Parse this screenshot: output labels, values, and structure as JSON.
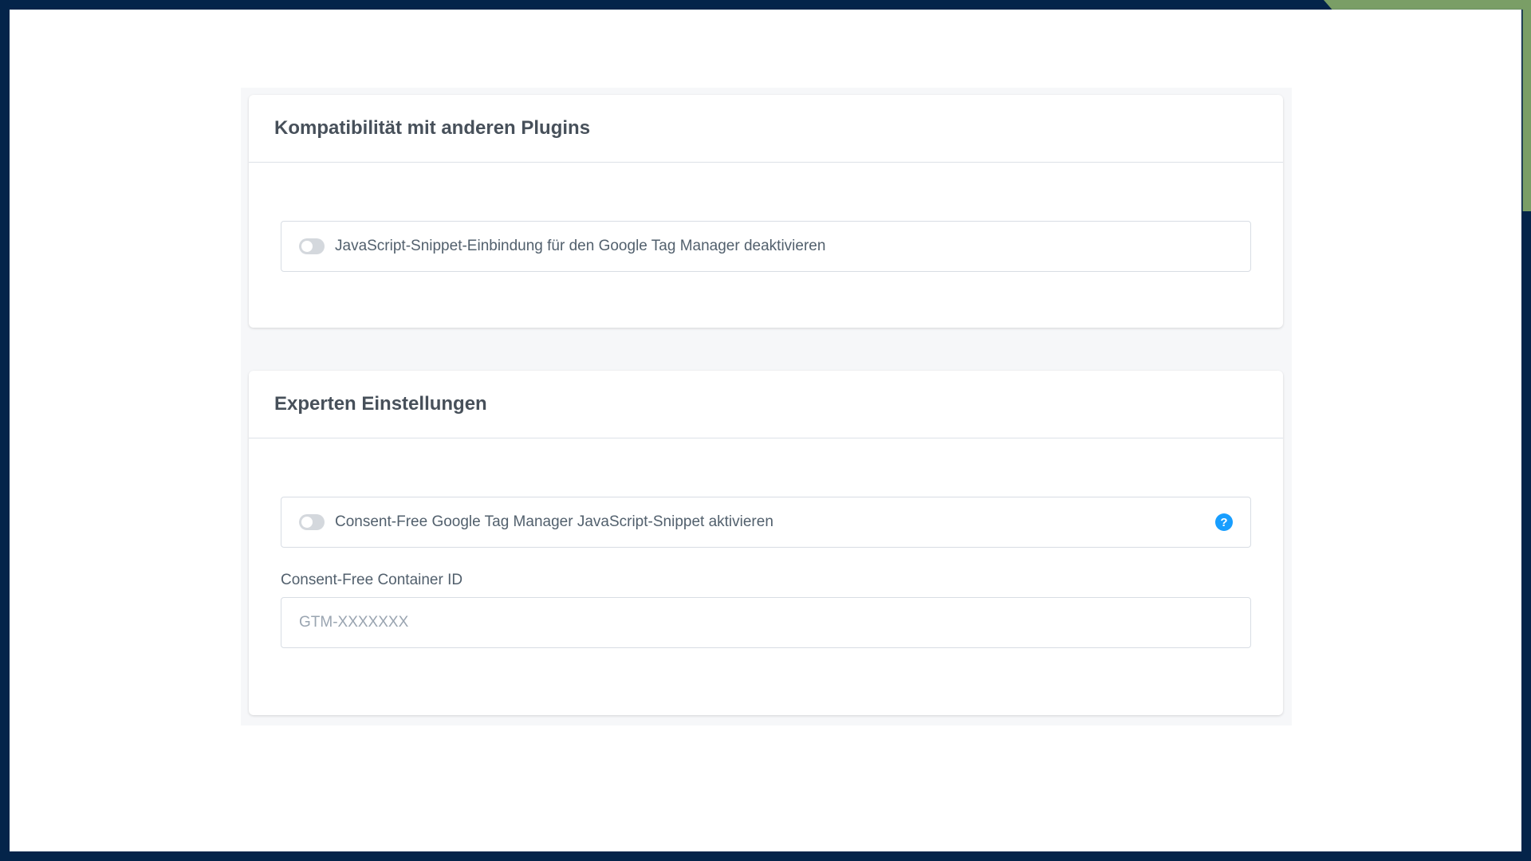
{
  "colors": {
    "frame": "#04244a",
    "accent": "#7a9e66",
    "help_icon": "#189eff",
    "toggle_off": "#d4d8dd"
  },
  "compat_card": {
    "title": "Kompatibilität mit anderen Plugins",
    "toggle": {
      "label": "JavaScript-Snippet-Einbindung für den Google Tag Manager deaktivieren",
      "enabled": false
    }
  },
  "expert_card": {
    "title": "Experten Einstellungen",
    "toggle": {
      "label": "Consent-Free Google Tag Manager JavaScript-Snippet aktivieren",
      "enabled": false
    },
    "help_icon": {
      "glyph": "?",
      "icon": "question-circle-icon"
    },
    "container_id": {
      "label": "Consent-Free Container ID",
      "value": "",
      "placeholder": "GTM-XXXXXXX"
    }
  }
}
